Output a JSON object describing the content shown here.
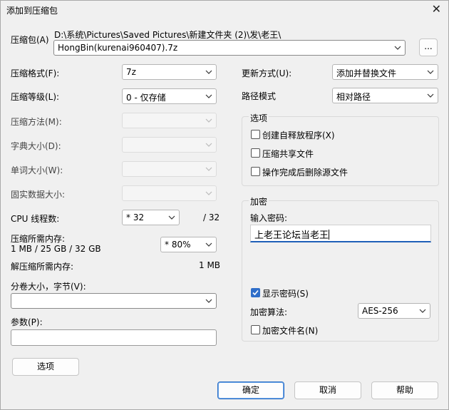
{
  "window": {
    "title": "添加到压缩包",
    "close_symbol": "✕"
  },
  "archive": {
    "label": "压缩包(A)",
    "path": "D:\\系统\\Pictures\\Saved Pictures\\新建文件夹 (2)\\发\\老王\\",
    "filename": "HongBin(kurenai960407).7z",
    "browse_label": "..."
  },
  "left": {
    "format": {
      "label": "压缩格式(F):",
      "value": "7z"
    },
    "level": {
      "label": "压缩等级(L):",
      "value": "0 - 仅存储"
    },
    "method": {
      "label": "压缩方法(M):",
      "value": ""
    },
    "dict": {
      "label": "字典大小(D):",
      "value": ""
    },
    "word": {
      "label": "单词大小(W):",
      "value": ""
    },
    "solid": {
      "label": "固实数据大小:",
      "value": ""
    },
    "threads": {
      "label": "CPU 线程数:",
      "value": "* 32",
      "max": "/ 32"
    },
    "mem_comp": {
      "label": "压缩所需内存:",
      "detail": "1 MB / 25 GB / 32 GB",
      "value": "* 80%"
    },
    "mem_decomp": {
      "label": "解压缩所需内存:",
      "value": "1 MB"
    },
    "split": {
      "label": "分卷大小，字节(V):",
      "value": ""
    },
    "params": {
      "label": "参数(P):",
      "value": ""
    },
    "options_button": "选项"
  },
  "right": {
    "update": {
      "label": "更新方式(U):",
      "value": "添加并替换文件"
    },
    "path_mode": {
      "label": "路径模式",
      "value": "相对路径"
    },
    "options_group": {
      "title": "选项",
      "sfx": "创建自释放程序(X)",
      "shared": "压缩共享文件",
      "delete": "操作完成后删除源文件"
    },
    "encryption": {
      "title": "加密",
      "password_label": "输入密码:",
      "password_value": "上老王论坛当老王",
      "show_password": "显示密码(S)",
      "algo_label": "加密算法:",
      "algo_value": "AES-256",
      "encrypt_names": "加密文件名(N)"
    }
  },
  "buttons": {
    "ok": "确定",
    "cancel": "取消",
    "help": "帮助"
  }
}
